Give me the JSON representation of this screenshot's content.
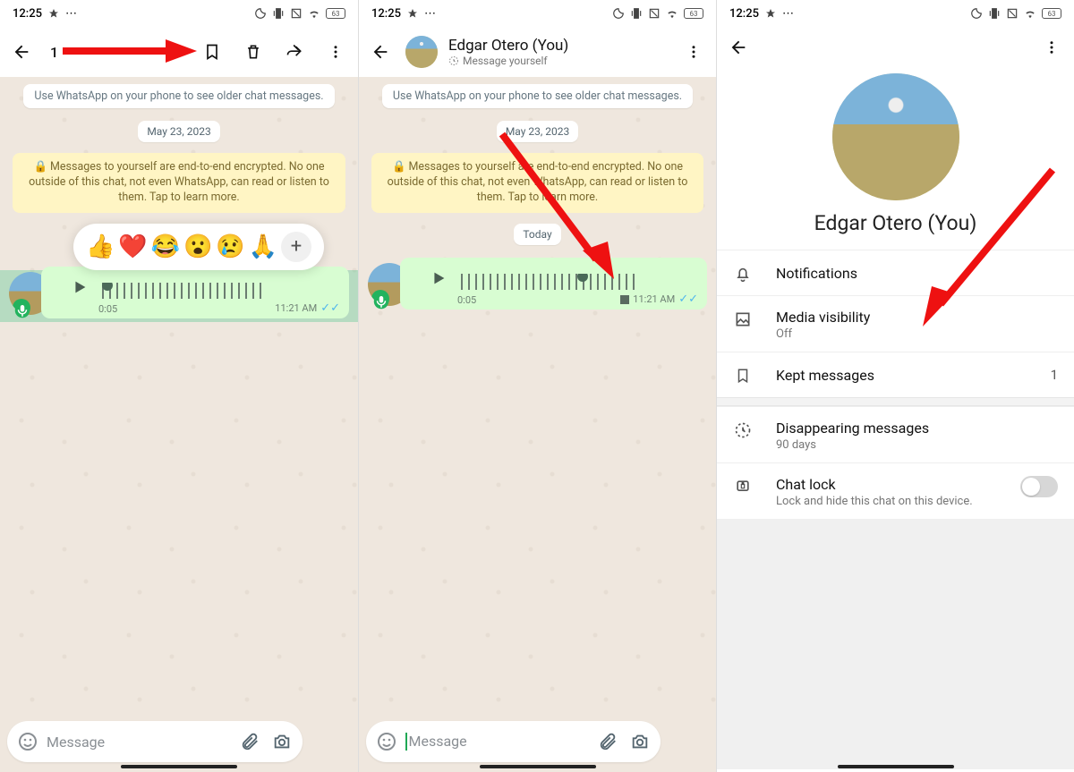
{
  "status": {
    "time": "12:25",
    "battery": "63"
  },
  "screen1": {
    "selection_count": "1",
    "older_pill": "Use WhatsApp on your phone to see older chat messages.",
    "date": "May 23, 2023",
    "encrypt": "Messages to yourself are end-to-end encrypted. No one outside of this chat, not even WhatsApp, can read or listen to them. Tap to learn more.",
    "voice_duration": "0:05",
    "voice_time": "11:21 AM",
    "reactions": [
      "👍",
      "❤️",
      "😂",
      "😮",
      "😢",
      "🙏"
    ],
    "composer_placeholder": "Message"
  },
  "screen2": {
    "contact_name": "Edgar Otero (You)",
    "contact_sub": "Message yourself",
    "older_pill": "Use WhatsApp on your phone to see older chat messages.",
    "date": "May 23, 2023",
    "encrypt": "Messages to yourself are end-to-end encrypted. No one outside of this chat, not even WhatsApp, can read or listen to them. Tap to learn more.",
    "today": "Today",
    "voice_duration": "0:05",
    "voice_time": "11:21 AM",
    "composer_placeholder": "Message"
  },
  "screen3": {
    "profile_name": "Edgar Otero (You)",
    "rows": {
      "notifications": "Notifications",
      "media_vis": "Media visibility",
      "media_vis_sub": "Off",
      "kept": "Kept messages",
      "kept_count": "1",
      "disappearing": "Disappearing messages",
      "disappearing_sub": "90 days",
      "chatlock": "Chat lock",
      "chatlock_sub": "Lock and hide this chat on this device."
    }
  }
}
